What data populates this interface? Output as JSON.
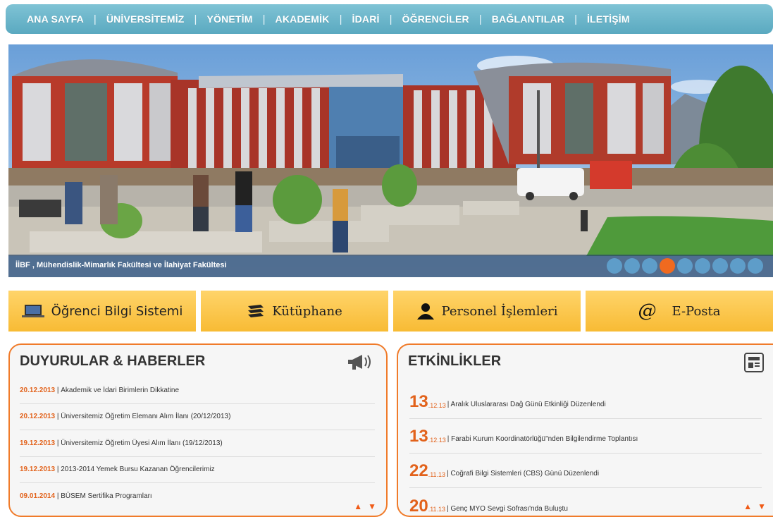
{
  "nav": {
    "items": [
      {
        "label": "ANA SAYFA"
      },
      {
        "label": "ÜNİVERSİTEMİZ"
      },
      {
        "label": "YÖNETİM"
      },
      {
        "label": "AKADEMİK"
      },
      {
        "label": "İDARİ"
      },
      {
        "label": "ÖĞRENCİLER"
      },
      {
        "label": "BAĞLANTILAR"
      },
      {
        "label": "İLETİŞİM"
      }
    ],
    "separator": "|"
  },
  "hero": {
    "caption": "İİBF , Mühendislik-Mimarlık Fakültesi ve İlahiyat Fakültesi",
    "slide_count": 9,
    "active_slide": 4
  },
  "quick_links": {
    "obs": "Öğrenci Bilgi Sistemi",
    "library": "Kütüphane",
    "staff": "Personel İşlemleri",
    "email": "E-Posta"
  },
  "news": {
    "title": "DUYURULAR & HABERLER",
    "icon": "megaphone-icon",
    "items": [
      {
        "date": "20.12.2013",
        "sep": " | ",
        "text": "Akademik ve İdari Birimlerin Dikkatine"
      },
      {
        "date": "20.12.2013",
        "sep": " | ",
        "text": "Üniversitemiz Öğretim Elemanı Alım İlanı (20/12/2013)"
      },
      {
        "date": "19.12.2013",
        "sep": " | ",
        "text": "Üniversitemiz Öğretim Üyesi Alım İlanı (19/12/2013)"
      },
      {
        "date": "19.12.2013",
        "sep": " | ",
        "text": "2013-2014 Yemek Bursu Kazanan Öğrencilerimiz"
      },
      {
        "date": "09.01.2014",
        "sep": " | ",
        "text": "BÜSEM Sertifika Programları"
      }
    ]
  },
  "events": {
    "title": "ETKİNLİKLER",
    "icon": "newspaper-icon",
    "items": [
      {
        "day": "13",
        "month": ".12.13",
        "text": "| Aralık Uluslararası Dağ Günü Etkinliği Düzenlendi"
      },
      {
        "day": "13",
        "month": ".12.13",
        "text": "| Farabi Kurum Koordinatörlüğü\"nden Bilgilendirme Toplantısı"
      },
      {
        "day": "22",
        "month": ".11.13",
        "text": "| Coğrafi Bilgi Sistemleri (CBS) Günü Düzenlendi"
      },
      {
        "day": "20",
        "month": ".11.13",
        "text": "| Genç MYO Sevgi Sofrası'nda Buluştu"
      }
    ]
  },
  "arrows": {
    "up": "▲",
    "down": "▼"
  },
  "colors": {
    "accent": "#f06a1f",
    "nav": "#6fb8cd",
    "quick": "#fbc445"
  }
}
